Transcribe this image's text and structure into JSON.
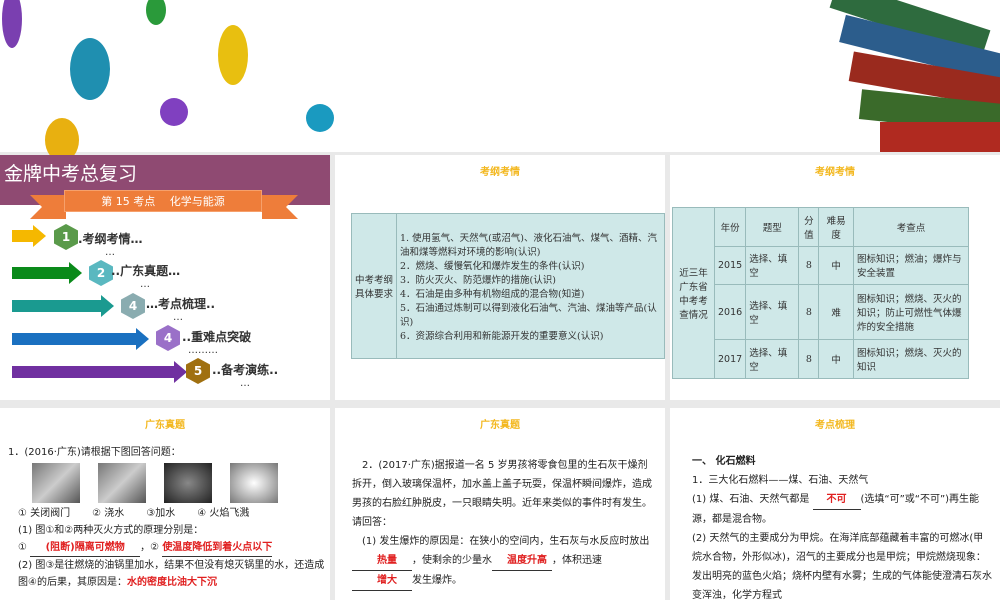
{
  "slide1": {
    "title": "金牌中考总复习",
    "ribbon": "第 15 考点　 化学与能源",
    "menu": [
      {
        "num": "1",
        "label": ".考纲考情…",
        "dots": "…"
      },
      {
        "num": "2",
        "label": "..广东真题…",
        "dots": "…"
      },
      {
        "num": "4",
        "label": "…考点梳理..",
        "dots": "…"
      },
      {
        "num": "4",
        "label": "..重难点突破",
        "dots": "………"
      },
      {
        "num": "5",
        "label": "..备考演练..",
        "dots": "…"
      }
    ],
    "colors": {
      "header": "#8f4a72",
      "ribbon": "#ee7d3a"
    }
  },
  "slide2": {
    "title": "考纲考情",
    "row_header": "中考考纲具体要求",
    "lines": [
      "1. 使用氢气、天然气(或沼气)、液化石油气、煤气、酒精、汽油和煤等燃料对环境的影响(认识)",
      "2．燃烧、缓慢氧化和爆炸发生的条件(认识)",
      "3．防火灭火、防范爆炸的措施(认识)",
      "4．石油是由多种有机物组成的混合物(知道)",
      "5．石油通过炼制可以得到液化石油气、汽油、煤油等产品(认识)",
      "6．资源综合利用和新能源开发的重要意义(认识)"
    ]
  },
  "slide3": {
    "title": "考纲考情",
    "row_header": "近三年广东省中考考查情况",
    "headers": [
      "年份",
      "题型",
      "分值",
      "难易度",
      "考查点"
    ],
    "rows": [
      [
        "2015",
        "选择、填空",
        "8",
        "中",
        "图标知识；燃油；爆炸与安全装置"
      ],
      [
        "2016",
        "选择、填空",
        "8",
        "难",
        "图标知识；燃烧、灭火的知识；防止可燃性气体爆炸的安全措施"
      ],
      [
        "2017",
        "选择、填空",
        "8",
        "中",
        "图标知识；燃烧、灭火的知识"
      ]
    ]
  },
  "slide4": {
    "title": "广东真题",
    "question": "1．(2016·广东)请根据下图回答问题：",
    "captions": [
      "① 关闭阀门",
      "② 浇水",
      "③加水",
      "④ 火焰飞溅"
    ],
    "q1": "(1) 图①和②两种灭火方式的原理分别是：",
    "a1": "(阻断)隔离可燃物",
    "a2": "使温度降低到着火点以下",
    "q2": "(2) 图③是往燃烧的油锅里加水，结果不但没有熄灭锅里的水，还造成图④的后果，其原因是：",
    "a3": "水的密度比油大下沉"
  },
  "slide5": {
    "title": "广东真题",
    "question": "2．(2017·广东)据报道一名 5 岁男孩将零食包里的生石灰干燥剂拆开，倒入玻璃保温杯，加水盖上盖子玩耍，保温杯瞬间爆炸，造成男孩的右脸红肿脱皮，一只眼睛失明。近年来类似的事件时有发生。请回答：",
    "q1a": "(1) 发生爆炸的原因是：在狭小的空间内，生石灰与水反应时放出",
    "a1": "热量",
    "q1b": "，使剩余的少量水",
    "a2": "温度升高",
    "q1c": "，体积迅速",
    "a3": "增大",
    "q1d": "发生爆炸。"
  },
  "slide6": {
    "title": "考点梳理",
    "section": "一、 化石燃料",
    "l1": "1．三大化石燃料——煤、石油、天然气",
    "l2a": "(1) 煤、石油、天然气都是",
    "a1": "不可",
    "l2b": "(选填“可”或“不可”)再生能源，都是混合物。",
    "l3": "(2) 天然气的主要成分为甲烷。在海洋底部蕴藏着丰富的可燃冰(甲烷水合物，外形似冰)，沼气的主要成分也是甲烷；甲烷燃烧现象：发出明亮的蓝色火焰；烧杯内壁有水雾；生成的气体能使澄清石灰水变浑浊，化学方程式"
  }
}
